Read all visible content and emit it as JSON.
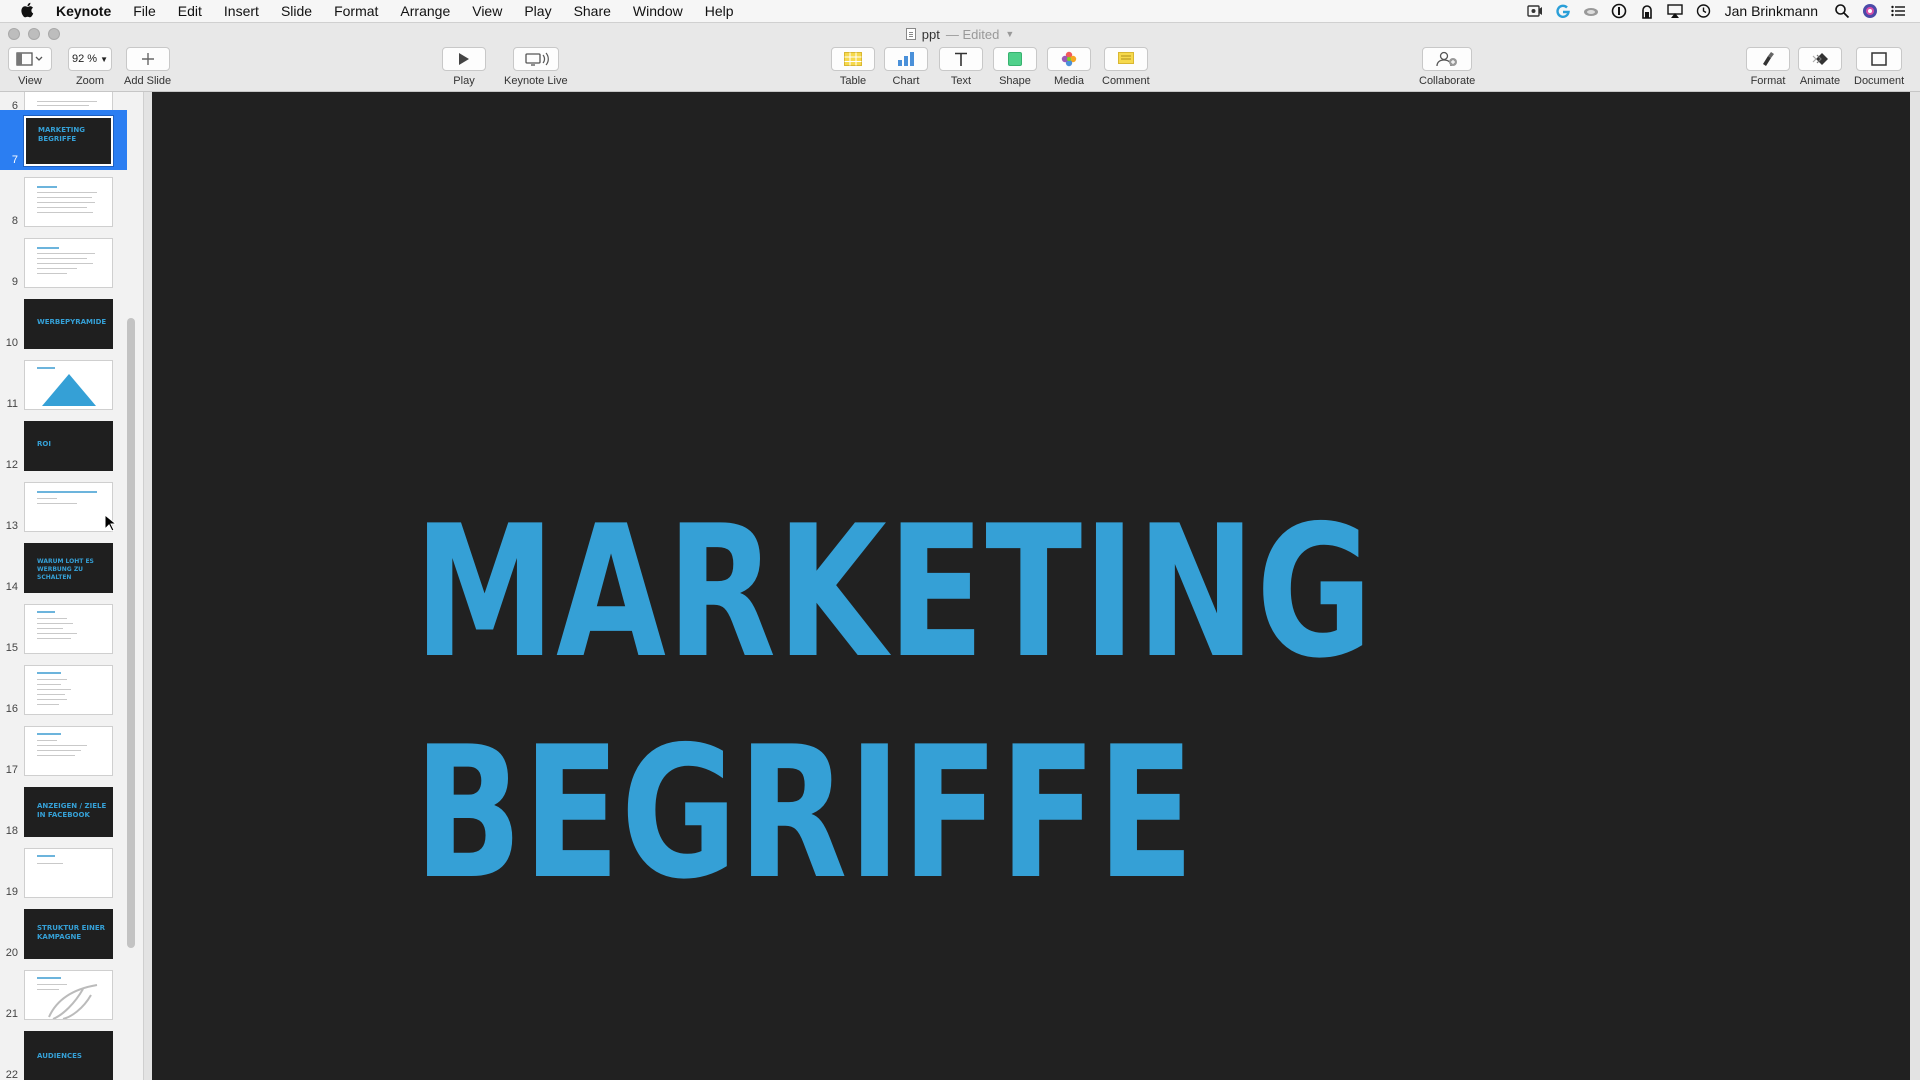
{
  "menubar": {
    "app": "Keynote",
    "items": [
      "File",
      "Edit",
      "Insert",
      "Slide",
      "Format",
      "Arrange",
      "View",
      "Play",
      "Share",
      "Window",
      "Help"
    ],
    "user": "Jan Brinkmann",
    "status_icons": [
      "screen-record-icon",
      "app-g-icon",
      "cloud-icon",
      "onepassword-icon",
      "lock-icon",
      "airplay-icon",
      "time-machine-icon",
      "spotlight-search-icon",
      "siri-icon",
      "notification-center-icon"
    ]
  },
  "window": {
    "doc_name": "ppt",
    "doc_status": "— Edited"
  },
  "toolbar": {
    "view": "View",
    "zoom": "Zoom",
    "zoom_value": "92 %",
    "add_slide": "Add Slide",
    "play": "Play",
    "keynote_live": "Keynote Live",
    "table": "Table",
    "chart": "Chart",
    "text": "Text",
    "shape": "Shape",
    "media": "Media",
    "comment": "Comment",
    "collaborate": "Collaborate",
    "format": "Format",
    "animate": "Animate",
    "document": "Document"
  },
  "navigator": {
    "slides": [
      {
        "number": "6",
        "type": "light",
        "title": ""
      },
      {
        "number": "7",
        "type": "dark",
        "title": "MARKETING\nBEGRIFFE",
        "selected": true
      },
      {
        "number": "8",
        "type": "light",
        "title": ""
      },
      {
        "number": "9",
        "type": "light",
        "title": ""
      },
      {
        "number": "10",
        "type": "dark",
        "title": "WERBEPYRAMIDE"
      },
      {
        "number": "11",
        "type": "pyramid",
        "title": ""
      },
      {
        "number": "12",
        "type": "dark",
        "title": "ROI"
      },
      {
        "number": "13",
        "type": "light",
        "title": ""
      },
      {
        "number": "14",
        "type": "dark",
        "title": "WARUM LOHT ES\nWERBUNG ZU SCHALTEN"
      },
      {
        "number": "15",
        "type": "light",
        "title": ""
      },
      {
        "number": "16",
        "type": "light",
        "title": ""
      },
      {
        "number": "17",
        "type": "light",
        "title": ""
      },
      {
        "number": "18",
        "type": "dark",
        "title": "ANZEIGEN / ZIELE\nIN FACEBOOK"
      },
      {
        "number": "19",
        "type": "light",
        "title": ""
      },
      {
        "number": "20",
        "type": "dark",
        "title": "STRUKTUR EINER\nKAMPAGNE"
      },
      {
        "number": "21",
        "type": "light",
        "title": ""
      },
      {
        "number": "22",
        "type": "dark",
        "title": "AUDIENCES"
      }
    ]
  },
  "slide": {
    "title": "MARKETING\nBEGRIFFE",
    "background": "#212121",
    "title_color": "#35a0d6"
  },
  "colors": {
    "accent": "#2b7ef2",
    "slide_blue": "#35a0d6"
  }
}
